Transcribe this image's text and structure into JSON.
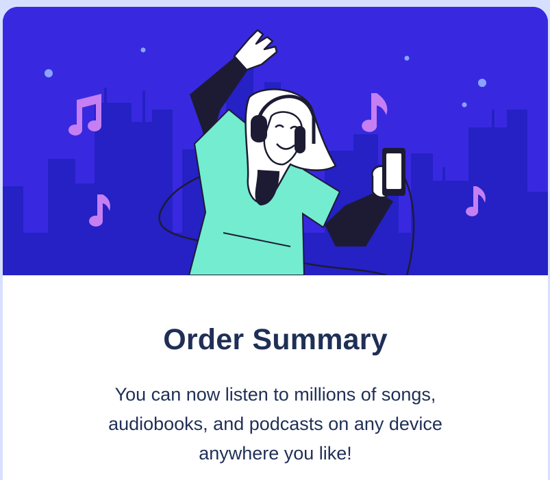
{
  "order_card": {
    "title": "Order Summary",
    "description": "You can now listen to millions of songs, audiobooks, and podcasts on any device anywhere you like!",
    "illustration": "person-listening-music-with-headphones",
    "icons": [
      "music-note-icon",
      "headphones-icon",
      "phone-icon"
    ]
  },
  "colors": {
    "hero_background": "#3829e0",
    "skyline": "#2521c4",
    "shirt": "#73ecd0",
    "music_note": "#c57ff3",
    "title_text": "#1f2f56",
    "page_background": "#d6e0fe",
    "card_background": "#ffffff"
  }
}
